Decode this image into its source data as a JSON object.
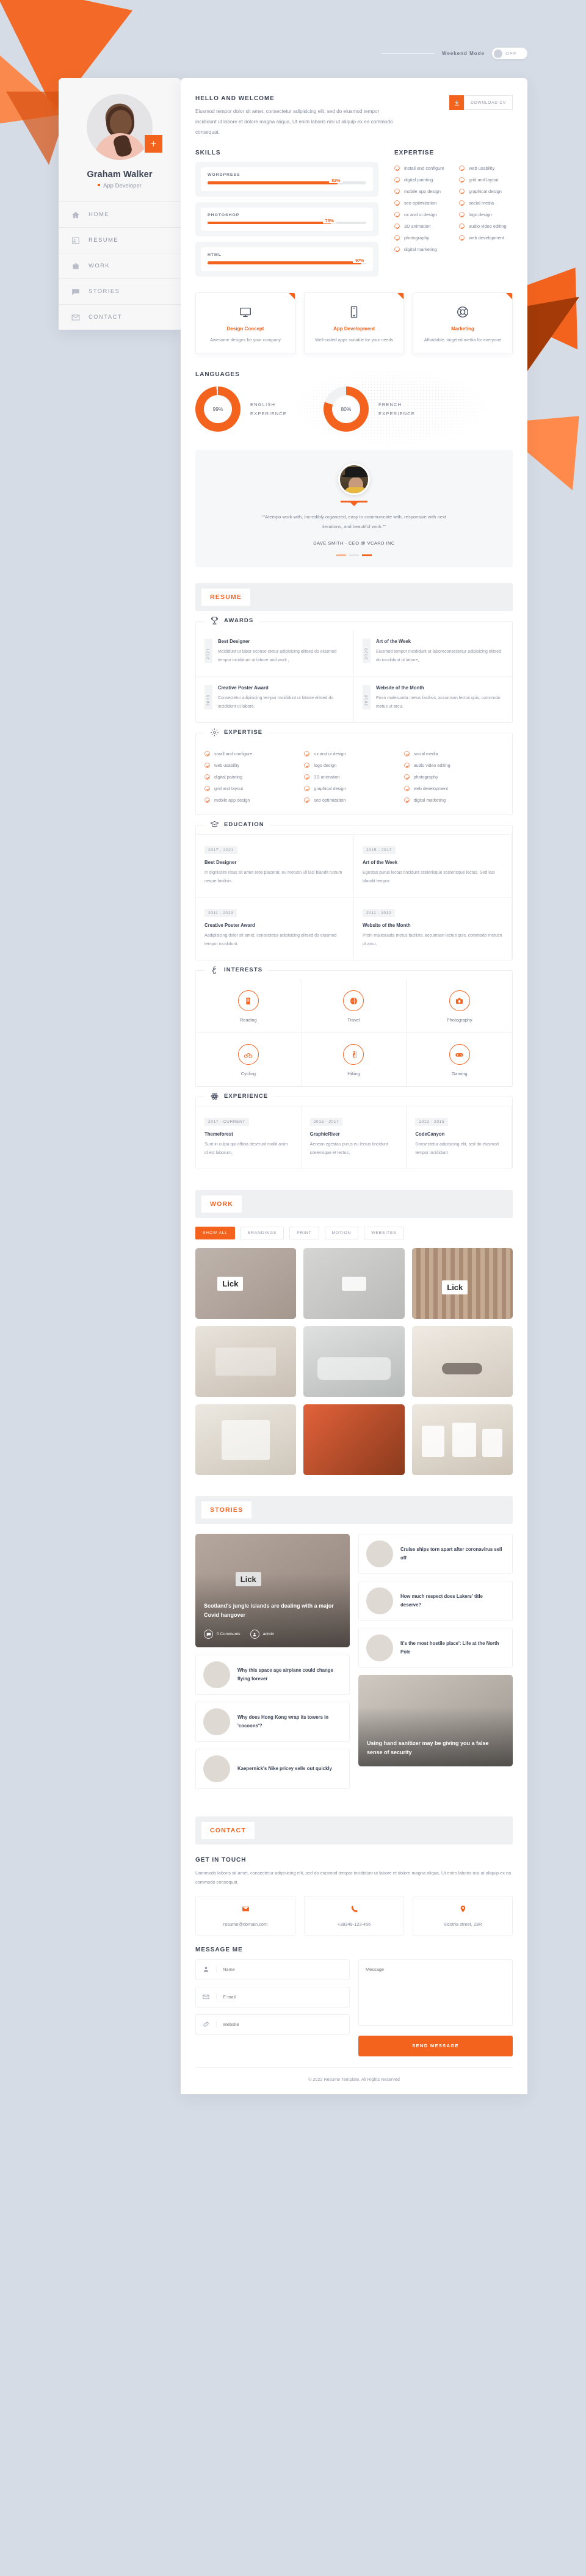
{
  "topbar": {
    "weekend_mode_label": "Weekend Mode",
    "toggle_state": "OFF"
  },
  "profile": {
    "name": "Graham Walker",
    "role": "App Developer",
    "plus_icon": "+",
    "nav": [
      {
        "label": "HOME",
        "icon": "home-icon"
      },
      {
        "label": "RESUME",
        "icon": "resume-icon"
      },
      {
        "label": "WORK",
        "icon": "briefcase-icon"
      },
      {
        "label": "STORIES",
        "icon": "chat-icon"
      },
      {
        "label": "CONTACT",
        "icon": "envelope-icon"
      }
    ]
  },
  "hello": {
    "title": "HELLO AND WELCOME",
    "text": "Eiusmod tempor dolor sit amet, consectetur adipisicing elit, sed do eiusmod tempor incididunt ut labore et dolore magna aliqua, Ut enim laboris nisi ut aliquip ex ea commodo consequat.",
    "download_label": "DOWNLOAD CV"
  },
  "skills": {
    "title": "SKILLS",
    "items": [
      {
        "name": "WORDPRESS",
        "value": 82,
        "display": "82%"
      },
      {
        "name": "PHOTOSHOP",
        "value": 78,
        "display": "78%"
      },
      {
        "name": "HTML",
        "value": 97,
        "display": "97%"
      }
    ]
  },
  "expertise": {
    "title": "EXPERTISE",
    "col1": [
      "install and configure",
      "digital painting",
      "mobile app design",
      "seo optimization",
      "ux and ui design",
      "3D animation",
      "photography",
      "digital marketing"
    ],
    "col2": [
      "web usability",
      "grid and layout",
      "graphical design",
      "social media",
      "logo design",
      "audio video editing",
      "web development"
    ]
  },
  "services": [
    {
      "icon": "monitor-icon",
      "title": "Design Concept",
      "text": "Awesome designs for your company"
    },
    {
      "icon": "mobile-icon",
      "title": "App Development",
      "text": "Well-coded apps suitable for your needs"
    },
    {
      "icon": "lifebuoy-icon",
      "title": "Marketing",
      "text": "Affordable, targeted media for everyone"
    }
  ],
  "languages": {
    "title": "LANGUAGES",
    "items": [
      {
        "percent": 99,
        "display": "99%",
        "line1": "ENGLISH",
        "line2": "EXPERIENCE"
      },
      {
        "percent": 80,
        "display": "80%",
        "line1": "FRENCH",
        "line2": "EXPERIENCE"
      }
    ]
  },
  "testimonial": {
    "quote": "“Atempo work with, Incredibly organized, easy to communicate with, responsive with next iterations, and beautiful work.”",
    "author": "DAVE SMITH - CEO @ VCARD INC"
  },
  "resume": {
    "banner": "RESUME",
    "awards": {
      "title": "AWARDS",
      "icon": "trophy-icon",
      "items": [
        {
          "year": "2021",
          "title": "Best Designer",
          "text": "Mcididunt ut labor econse ctetur adipisicing elitsed do eiusmod tempor incididunt ut labore and work ,"
        },
        {
          "year": "2020",
          "title": "Art of the Week",
          "text": "Eiusmod tempor mcididunt ut laboreconsectetur adipisicing elitsed do incididunt ut labore,"
        },
        {
          "year": "2019",
          "title": "Creative Poster Award",
          "text": "Consectetur adipisicing tempor mcididunt ut labore elitsed do incididunt ut labore."
        },
        {
          "year": "2018",
          "title": "Website of the Month",
          "text": "Proin malesuada metus facilisis, accumsan lectus quis, commodo metus ut arcu."
        }
      ]
    },
    "expertise_block": {
      "title": "EXPERTISE",
      "icon": "gear-icon",
      "col1": [
        "small and configure",
        "web usability",
        "digital painting",
        "grid and layout",
        "mobile app design"
      ],
      "col2": [
        "ux and ui design",
        "logo design",
        "3D animation",
        "graphical design",
        "seo optimization"
      ],
      "col3": [
        "social media",
        "audio video editing",
        "photography",
        "web development",
        "digital marketing"
      ]
    },
    "education": {
      "title": "EDUCATION",
      "icon": "graduation-icon",
      "items": [
        {
          "year": "2017 - 2021",
          "title": "Best Designer",
          "text": "In dignissim risus sit amet eros placerat, eu metusn ull laci blandit rutrum neque facilisis."
        },
        {
          "year": "2015 - 2017",
          "title": "Art of the Week",
          "text": "Egestas purus lectus tincidunt scelerisque scelerisque lectus. Sed laci blandit tempor."
        },
        {
          "year": "2011 - 2013",
          "title": "Creative Poster Award",
          "text": "Aadipisicing dolor sit amet, consectetur adipisicing elitsed do eiusmod tempor incididunt."
        },
        {
          "year": "2011 - 2012",
          "title": "Website of the Month",
          "text": "Proin malesuada metus facilisis, accumsan lectus quis, commodo metusn ut arcu."
        }
      ]
    },
    "interests": {
      "title": "INTERESTS",
      "icon": "head-heart-icon",
      "items": [
        {
          "label": "Reading",
          "icon": "book-icon"
        },
        {
          "label": "Travel",
          "icon": "globe-icon"
        },
        {
          "label": "Photography",
          "icon": "camera-icon"
        },
        {
          "label": "Cycling",
          "icon": "bicycle-icon"
        },
        {
          "label": "Hiking",
          "icon": "hiker-icon"
        },
        {
          "label": "Gaming",
          "icon": "gamepad-icon"
        }
      ]
    },
    "experience": {
      "title": "EXPERIENCE",
      "icon": "atom-icon",
      "items": [
        {
          "year": "2017 - CURRENT",
          "title": "Themeforest",
          "text": "Sunt in culpa qui officia deserunt mollit anim id est laborum,"
        },
        {
          "year": "2015 - 2017",
          "title": "GraphicRiver",
          "text": "Aenean egestas purus eu lectus tincidunt scelerisque et lectus,"
        },
        {
          "year": "2012 - 2015",
          "title": "CodeCanyon",
          "text": "Donsectetur adipisicing elit, sed do eiusmod tempor incididunt"
        }
      ]
    }
  },
  "work": {
    "banner": "WORK",
    "filters": [
      "SHOW ALL",
      "BRANDINGS",
      "PRINT",
      "MOTION",
      "WEBSITES"
    ],
    "active_filter": "SHOW ALL",
    "tiles": [
      "Lick",
      "",
      "Lick",
      "",
      "",
      "",
      "",
      "",
      ""
    ]
  },
  "stories": {
    "banner": "STORIES",
    "featured": {
      "title": "Scotland's jungle islands are dealing with a major Covid hangover",
      "comments": "0 Comments",
      "author": "admin"
    },
    "featured2": {
      "title": "Using hand sanitizer may be giving you a false sense of security"
    },
    "left_cards": [
      {
        "title": "Why this space age airplane could change flying forever"
      },
      {
        "title": "Why does Hong Kong wrap its towers in 'cocoons'?"
      },
      {
        "title": "Kaepernick's Nike pricey sells out quickly"
      }
    ],
    "right_cards": [
      {
        "title": "Cruise ships torn apart after coronavirus sell off"
      },
      {
        "title": "How much respect does Lakers' title deserve?"
      },
      {
        "title": "It's the most hostile place': Life at the North Pole"
      }
    ]
  },
  "contact": {
    "banner": "CONTACT",
    "get_in_touch_title": "GET IN TOUCH",
    "get_in_touch_text": "Uommodo laboris sit amet, consectetur adipisicing elit, sed do eiusmod tempor incididunt ut labore et dolore magna aliqua, Ut enim laboris nisi ut aliquip ex ea commodo consequat.",
    "cards": [
      {
        "icon": "envelope-icon",
        "value": "resume@domain.com"
      },
      {
        "icon": "phone-icon",
        "value": "+38349-123-456"
      },
      {
        "icon": "map-pin-icon",
        "value": "Vicotria street, 23R"
      }
    ],
    "message_title": "MESSAGE ME",
    "fields": {
      "name_placeholder": "Name",
      "email_placeholder": "E-mail",
      "website_placeholder": "Website",
      "message_placeholder": "Message"
    },
    "send_label": "SEND MESSAGE"
  },
  "footer": {
    "text": "© 2022 Resume Template, All Rights Reserved"
  },
  "colors": {
    "accent": "#f4631e",
    "bg": "#d6dce5",
    "text": "#4a5160"
  }
}
